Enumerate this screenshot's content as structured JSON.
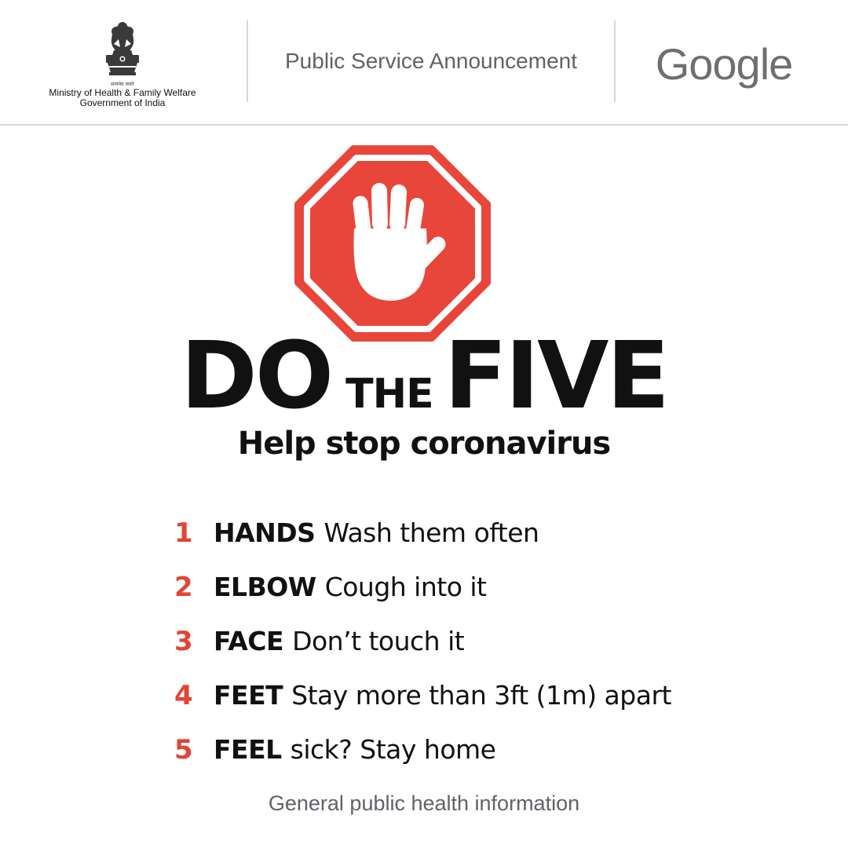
{
  "header": {
    "emblem_motto": "सत्यमेव जयते",
    "ministry_line1": "Ministry of Health & Family Welfare",
    "ministry_line2": "Government of India",
    "psa": "Public Service Announcement",
    "google_logo": "Google"
  },
  "icons": {
    "stop_sign": "stop-hand-icon",
    "emblem": "national-emblem-icon"
  },
  "colors": {
    "stop_red": "#e9463b",
    "number_red": "#e24536",
    "logo_gray": "#6f6f70"
  },
  "headline": {
    "word1": "DO",
    "word2": "THE",
    "word3": "FIVE"
  },
  "subtitle": "Help stop coronavirus",
  "steps": [
    {
      "num": "1",
      "key": "HANDS",
      "text": "Wash them often"
    },
    {
      "num": "2",
      "key": "ELBOW",
      "text": "Cough into it"
    },
    {
      "num": "3",
      "key": "FACE",
      "text": "Don’t touch it"
    },
    {
      "num": "4",
      "key": "FEET",
      "text": "Stay more than 3ft (1m) apart"
    },
    {
      "num": "5",
      "key": "FEEL",
      "text": "sick? Stay home"
    }
  ],
  "footer": "General public health information"
}
